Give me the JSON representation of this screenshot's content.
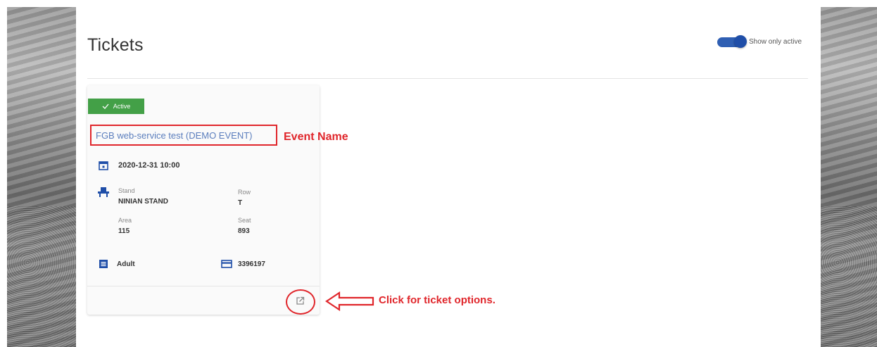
{
  "page": {
    "title": "Tickets"
  },
  "filter": {
    "toggle_label": "Show only active",
    "toggle_on": true
  },
  "ticket": {
    "status": "Active",
    "event_name": "FGB web-service test (DEMO EVENT)",
    "datetime": "2020-12-31 10:00",
    "stand_label": "Stand",
    "stand_value": "NINIAN STAND",
    "row_label": "Row",
    "row_value": "T",
    "area_label": "Area",
    "area_value": "115",
    "seat_label": "Seat",
    "seat_value": "893",
    "ticket_type": "Adult",
    "ticket_number": "3396197"
  },
  "annotations": {
    "event_name": "Event Name",
    "ticket_options": "Click for ticket options."
  },
  "colors": {
    "accent": "#2f5fb3",
    "active_badge": "#43a047",
    "annotation_red": "#e0262b",
    "link_blue": "#5b7ebd"
  },
  "icons": [
    "check-icon",
    "calendar-icon",
    "seat-icon",
    "ticket-type-icon",
    "card-icon",
    "open-external-icon"
  ]
}
